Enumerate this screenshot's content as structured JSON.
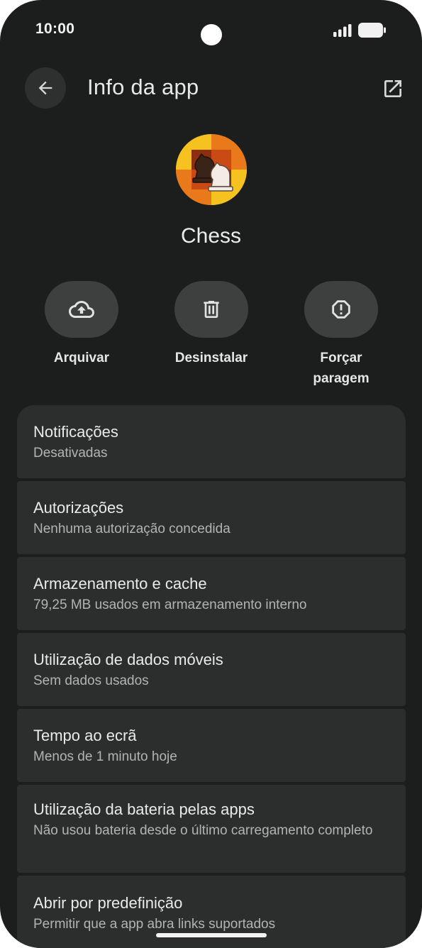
{
  "status_bar": {
    "time": "10:00"
  },
  "header": {
    "title": "Info da app",
    "back_icon": "arrow-left-icon",
    "open_icon": "open-in-new-icon"
  },
  "app": {
    "name": "Chess",
    "icon": "chess-knight-icon"
  },
  "actions": [
    {
      "label": "Arquivar",
      "icon": "cloud-upload-icon"
    },
    {
      "label": "Desinstalar",
      "icon": "trash-icon"
    },
    {
      "label": "Forçar paragem",
      "icon": "alert-octagon-icon"
    }
  ],
  "settings": [
    {
      "title": "Notificações",
      "subtitle": "Desativadas"
    },
    {
      "title": "Autorizações",
      "subtitle": "Nenhuma autorização concedida"
    },
    {
      "title": "Armazenamento e cache",
      "subtitle": "79,25 MB usados em armazenamento interno"
    },
    {
      "title": "Utilização de dados móveis",
      "subtitle": "Sem dados usados"
    },
    {
      "title": "Tempo ao ecrã",
      "subtitle": "Menos de 1 minuto hoje"
    },
    {
      "title": "Utilização da bateria pelas apps",
      "subtitle": "Não usou bateria desde o último carregamento completo"
    },
    {
      "title": "Abrir por predefinição",
      "subtitle": "Permitir que a app abra links suportados"
    }
  ],
  "colors": {
    "background": "#1c1d1d",
    "card": "#2c2e2e",
    "action_button": "#3d403f"
  }
}
